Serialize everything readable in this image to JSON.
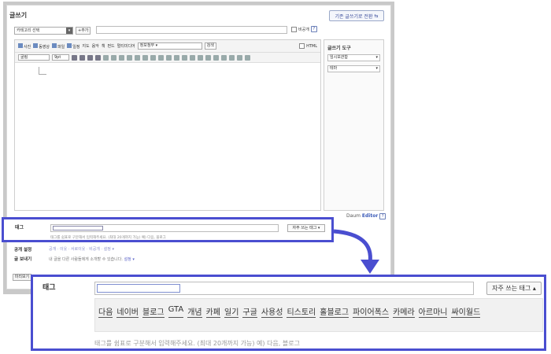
{
  "editor": {
    "title": "글쓰기",
    "switch_label": "기존 글쓰기로 전환",
    "category_placeholder": "카테고리 선택",
    "category_add": "+추가",
    "private_label": "비공개",
    "help": "?",
    "toolbar1": [
      "사진",
      "동영상",
      "파일",
      "일정",
      "지도",
      "음악",
      "책",
      "펀드",
      "멀티미디어"
    ],
    "attach_select": "정보첨부 ▾",
    "search_label": "검색",
    "html_label": "HTML",
    "font_select": "굴림",
    "size_select": "9pt"
  },
  "side": {
    "title": "글쓰기 도구",
    "select1": "임시보관함",
    "select2": "테마"
  },
  "footer": {
    "daum": "Daum",
    "editor_label": "Editor",
    "help": "?"
  },
  "tag_small": {
    "label": "태그",
    "freq_button": "자주 쓰는 태그 ▾",
    "hint": "태그를 쉼표로 구분해서 입력해주세요. (최대 20개까지 가능) 예) 다음, 블로그"
  },
  "below": {
    "open_label": "공개 설정",
    "open_value": "공개 · 이웃 · 서로이웃 · 비공개 · 설정 ▾",
    "send_label": "글 보내기",
    "send_value": "내 글을 다른 사람들에게 소개할 수 있습니다.",
    "send_link": "설정 ▾",
    "prev_button": "미리보기"
  },
  "tag_zoom": {
    "label": "태그",
    "freq_button": "자주 쓰는 태그 ▴",
    "tags": [
      "다음",
      "네이버",
      "블로그",
      "GTA",
      "개념",
      "카페",
      "일기",
      "구글",
      "사용성",
      "티스토리",
      "홀블로그",
      "파이어폭스",
      "카메라",
      "아르마니",
      "싸이월드"
    ],
    "hint": "태그를 쉼표로 구분해서 입력해주세요. (최대 20개까지 가능) 예) 다음, 블로그"
  },
  "colors": {
    "highlight": "#4a4ed0",
    "link": "#3b4d9c"
  }
}
